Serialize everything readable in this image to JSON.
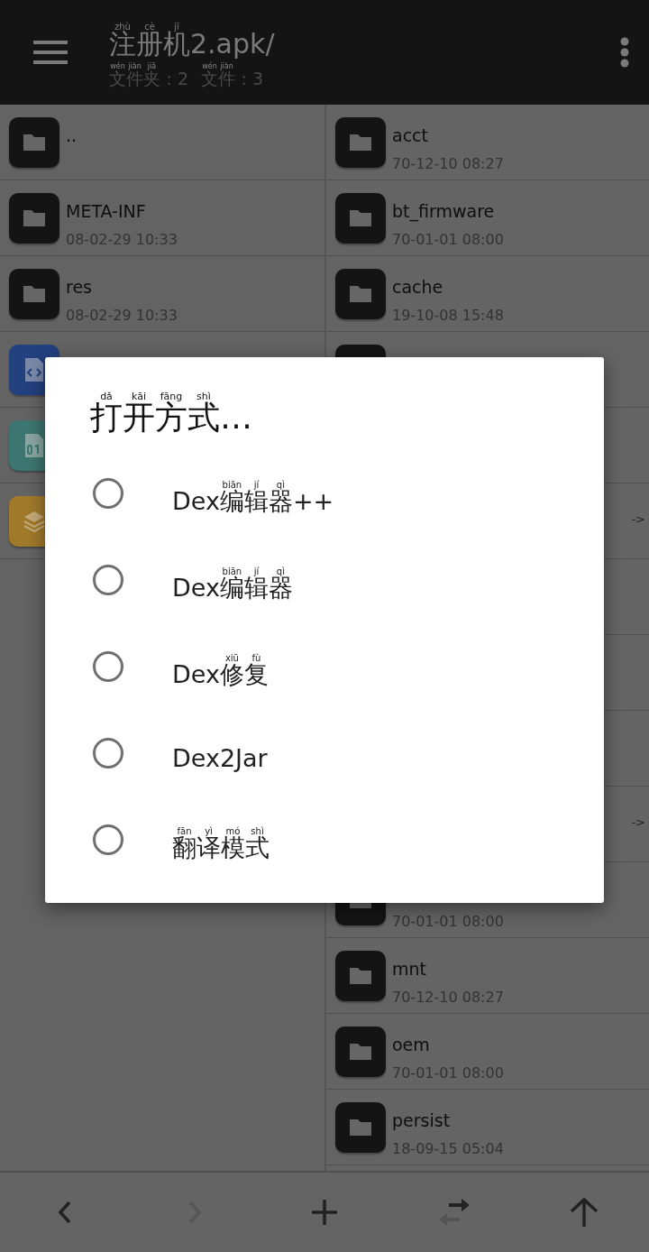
{
  "toolbar": {
    "title": [
      {
        "t": "注",
        "r": "zhù"
      },
      {
        "t": "册",
        "r": "cè"
      },
      {
        "t": "机",
        "r": "jī"
      },
      {
        "t": "2.apk/"
      }
    ],
    "stats": [
      [
        {
          "t": "文",
          "r": "wén"
        },
        {
          "t": "件",
          "r": "jiàn"
        },
        {
          "t": "夹",
          "r": "jiā"
        },
        {
          "t": "：2"
        }
      ],
      [
        {
          "t": "文",
          "r": "wén"
        },
        {
          "t": "件",
          "r": "jiàn"
        },
        {
          "t": "：3"
        }
      ]
    ]
  },
  "left_pane": [
    {
      "kind": "folder",
      "name": ".."
    },
    {
      "kind": "folder",
      "name": "META-INF",
      "date": "08-02-29 10:33"
    },
    {
      "kind": "folder",
      "name": "res",
      "date": "08-02-29 10:33"
    },
    {
      "kind": "code"
    },
    {
      "kind": "binary"
    },
    {
      "kind": "layers"
    }
  ],
  "right_pane": [
    {
      "kind": "folder",
      "name": "acct",
      "date": "70-12-10 08:27"
    },
    {
      "kind": "folder",
      "name": "bt_firmware",
      "date": "70-01-01 08:00"
    },
    {
      "kind": "folder",
      "name": "cache",
      "date": "19-10-08 15:48"
    },
    {
      "kind": "folder"
    },
    {
      "kind": "none"
    },
    {
      "kind": "none",
      "suffix": "->"
    },
    {
      "kind": "none"
    },
    {
      "kind": "none"
    },
    {
      "kind": "none"
    },
    {
      "kind": "none",
      "suffix": "->"
    },
    {
      "kind": "folder",
      "date": "70-01-01 08:00"
    },
    {
      "kind": "folder",
      "name": "mnt",
      "date": "70-12-10 08:27"
    },
    {
      "kind": "folder",
      "name": "oem",
      "date": "70-01-01 08:00"
    },
    {
      "kind": "folder",
      "name": "persist",
      "date": "18-09-15 05:04"
    }
  ],
  "dialog": {
    "title": [
      {
        "t": "打",
        "r": "dǎ"
      },
      {
        "t": "开",
        "r": "kāi"
      },
      {
        "t": "方",
        "r": "fāng"
      },
      {
        "t": "式",
        "r": "shì"
      },
      {
        "t": "…"
      }
    ],
    "options": [
      {
        "selected": false,
        "label": [
          {
            "t": "Dex"
          },
          {
            "t": "编",
            "r": "biān"
          },
          {
            "t": "辑",
            "r": "jí"
          },
          {
            "t": "器",
            "r": "qì"
          },
          {
            "t": "++"
          }
        ]
      },
      {
        "selected": false,
        "label": [
          {
            "t": "Dex"
          },
          {
            "t": "编",
            "r": "biān"
          },
          {
            "t": "辑",
            "r": "jí"
          },
          {
            "t": "器",
            "r": "qì"
          }
        ]
      },
      {
        "selected": false,
        "label": [
          {
            "t": "Dex"
          },
          {
            "t": "修",
            "r": "xiū"
          },
          {
            "t": "复",
            "r": "fù"
          }
        ]
      },
      {
        "selected": false,
        "label": [
          {
            "t": "Dex2Jar"
          }
        ]
      },
      {
        "selected": false,
        "label": [
          {
            "t": "翻",
            "r": "fān"
          },
          {
            "t": "译",
            "r": "yì"
          },
          {
            "t": "模",
            "r": "mó"
          },
          {
            "t": "式",
            "r": "shì"
          }
        ]
      }
    ]
  },
  "bottom_bar": [
    {
      "kind": "back",
      "disabled": false
    },
    {
      "kind": "forward",
      "disabled": true
    },
    {
      "kind": "add",
      "disabled": false
    },
    {
      "kind": "swap",
      "disabled": false
    },
    {
      "kind": "up",
      "disabled": false
    }
  ]
}
